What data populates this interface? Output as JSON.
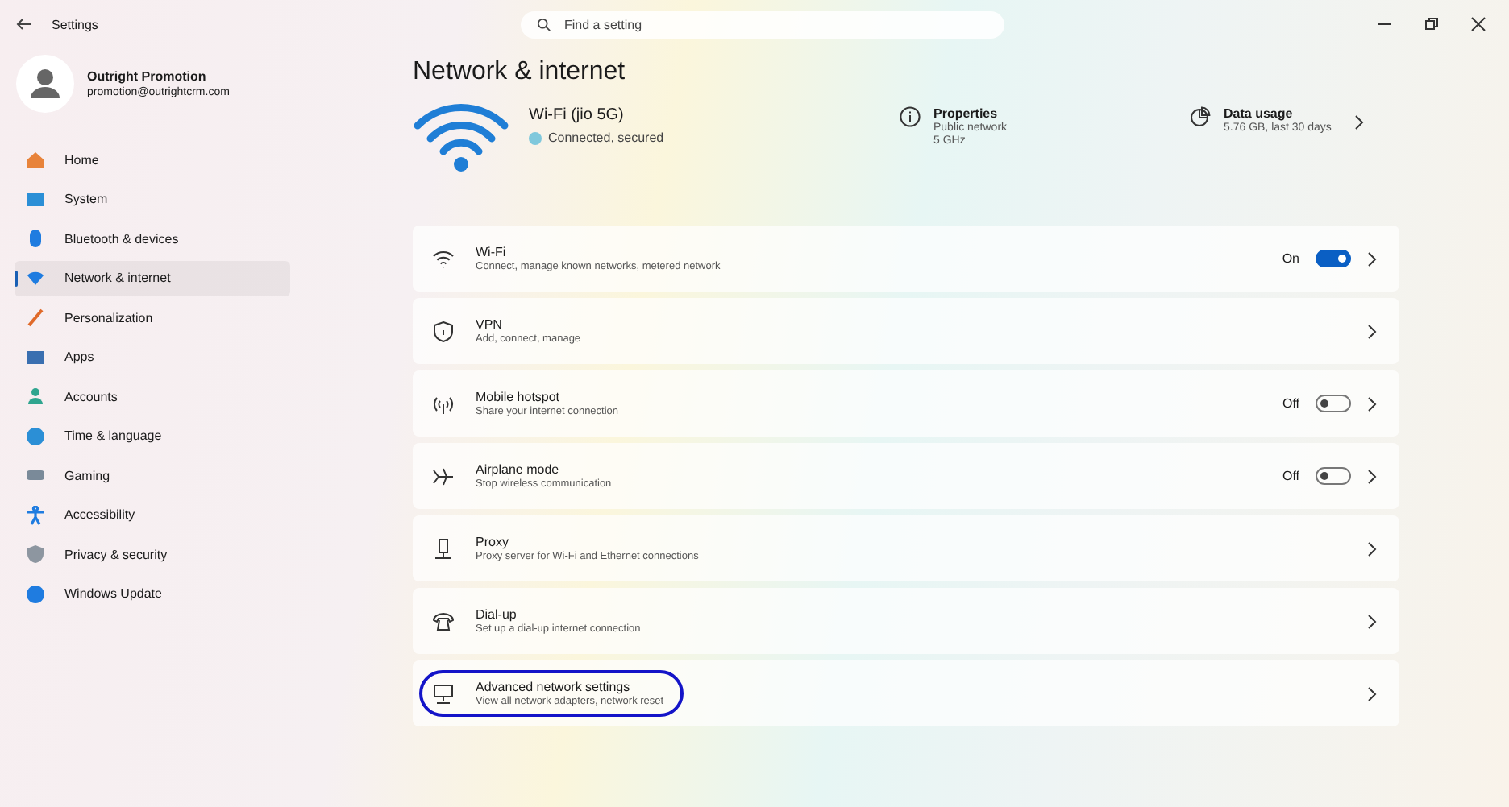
{
  "window": {
    "title": "Settings"
  },
  "search": {
    "placeholder": "Find a setting"
  },
  "account": {
    "name": "Outright Promotion",
    "email": "promotion@outrightcrm.com"
  },
  "sidebar": {
    "items": [
      {
        "label": "Home",
        "selected": false
      },
      {
        "label": "System",
        "selected": false
      },
      {
        "label": "Bluetooth & devices",
        "selected": false
      },
      {
        "label": "Network & internet",
        "selected": true
      },
      {
        "label": "Personalization",
        "selected": false
      },
      {
        "label": "Apps",
        "selected": false
      },
      {
        "label": "Accounts",
        "selected": false
      },
      {
        "label": "Time & language",
        "selected": false
      },
      {
        "label": "Gaming",
        "selected": false
      },
      {
        "label": "Accessibility",
        "selected": false
      },
      {
        "label": "Privacy & security",
        "selected": false
      },
      {
        "label": "Windows Update",
        "selected": false
      }
    ]
  },
  "page_title": "Network & internet",
  "connection": {
    "name": "Wi-Fi (jio 5G)",
    "status": "Connected, secured"
  },
  "properties": {
    "title": "Properties",
    "lines": [
      "Public network",
      "5 GHz"
    ]
  },
  "data_usage": {
    "title": "Data usage",
    "detail": "5.76 GB, last 30 days"
  },
  "settings": [
    {
      "title": "Wi-Fi",
      "subtitle": "Connect, manage known networks, metered network",
      "kind": "switch",
      "state_text": "On",
      "on": true,
      "highlighted": false
    },
    {
      "title": "VPN",
      "subtitle": "Add, connect, manage",
      "kind": "link",
      "highlighted": false
    },
    {
      "title": "Mobile hotspot",
      "subtitle": "Share your internet connection",
      "kind": "switch",
      "state_text": "Off",
      "on": false,
      "highlighted": false
    },
    {
      "title": "Airplane mode",
      "subtitle": "Stop wireless communication",
      "kind": "switch",
      "state_text": "Off",
      "on": false,
      "highlighted": false
    },
    {
      "title": "Proxy",
      "subtitle": "Proxy server for Wi-Fi and Ethernet connections",
      "kind": "link",
      "highlighted": false
    },
    {
      "title": "Dial-up",
      "subtitle": "Set up a dial-up internet connection",
      "kind": "link",
      "highlighted": false
    },
    {
      "title": "Advanced network settings",
      "subtitle": "View all network adapters, network reset",
      "kind": "link",
      "highlighted": true
    }
  ]
}
